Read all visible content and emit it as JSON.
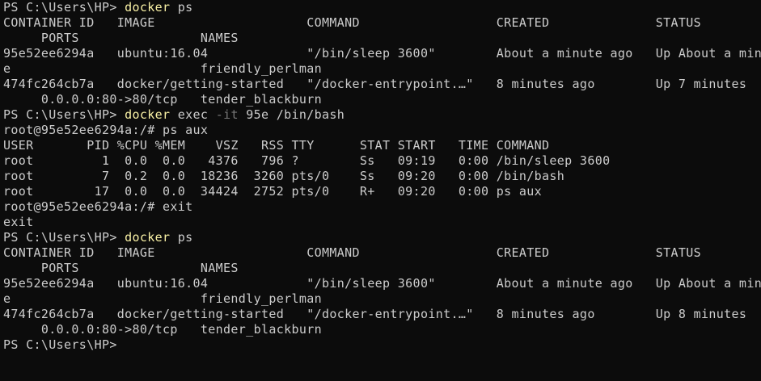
{
  "theme": {
    "background": "#0c0c0c",
    "foreground": "#cccccc",
    "command_color": "#f9f1a5",
    "flag_color": "#767676"
  },
  "terminal": {
    "lines": [
      {
        "prompt": "PS C:\\Users\\HP> ",
        "cmd": "docker",
        "rest": " ps"
      },
      {
        "text": "CONTAINER ID   IMAGE                    COMMAND                  CREATED              STATUS"
      },
      {
        "text": "     PORTS                NAMES"
      },
      {
        "text": "95e52ee6294a   ubuntu:16.04             \"/bin/sleep 3600\"        About a minute ago   Up About a minut"
      },
      {
        "text": "e                         friendly_perlman"
      },
      {
        "text": "474fc264cb7a   docker/getting-started   \"/docker-entrypoint.…\"   8 minutes ago        Up 7 minutes"
      },
      {
        "text": "     0.0.0.0:80->80/tcp   tender_blackburn"
      },
      {
        "prompt": "PS C:\\Users\\HP> ",
        "cmd": "docker",
        "rest_before_flag": " exec ",
        "flag": "-it",
        "rest": " 95e /bin/bash"
      },
      {
        "text": "root@95e52ee6294a:/# ps aux"
      },
      {
        "text": "USER       PID %CPU %MEM    VSZ   RSS TTY      STAT START   TIME COMMAND"
      },
      {
        "text": "root         1  0.0  0.0   4376   796 ?        Ss   09:19   0:00 /bin/sleep 3600"
      },
      {
        "text": "root         7  0.2  0.0  18236  3260 pts/0    Ss   09:20   0:00 /bin/bash"
      },
      {
        "text": "root        17  0.0  0.0  34424  2752 pts/0    R+   09:20   0:00 ps aux"
      },
      {
        "text": "root@95e52ee6294a:/# exit"
      },
      {
        "text": "exit"
      },
      {
        "prompt": "PS C:\\Users\\HP> ",
        "cmd": "docker",
        "rest": " ps"
      },
      {
        "text": "CONTAINER ID   IMAGE                    COMMAND                  CREATED              STATUS"
      },
      {
        "text": "     PORTS                NAMES"
      },
      {
        "text": "95e52ee6294a   ubuntu:16.04             \"/bin/sleep 3600\"        About a minute ago   Up About a minut"
      },
      {
        "text": "e                         friendly_perlman"
      },
      {
        "text": "474fc264cb7a   docker/getting-started   \"/docker-entrypoint.…\"   8 minutes ago        Up 8 minutes"
      },
      {
        "text": "     0.0.0.0:80->80/tcp   tender_blackburn"
      },
      {
        "prompt": "PS C:\\Users\\HP>",
        "cmd": "",
        "rest": ""
      }
    ]
  }
}
